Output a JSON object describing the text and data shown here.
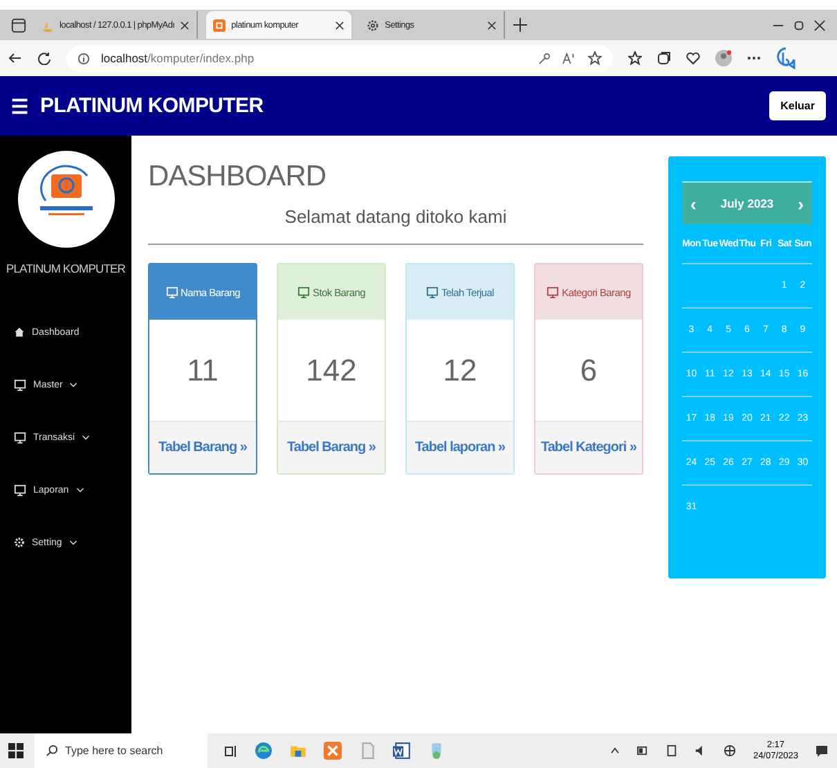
{
  "browser": {
    "tabs": [
      {
        "title": "localhost / 127.0.0.1 | phpMyAdı",
        "kind": "pma",
        "selected": false
      },
      {
        "title": "platinum komputer",
        "kind": "site",
        "selected": true
      },
      {
        "title": "Settings",
        "kind": "settings",
        "selected": false
      }
    ],
    "url_host": "localhost",
    "url_path": "/komputer/index.php"
  },
  "navbar": {
    "menu_glyph": "☰",
    "title": "PLATINUM KOMPUTER",
    "logout": "Keluar"
  },
  "sidebar": {
    "brand": "PLATINUM KOMPUTER",
    "items": [
      {
        "label": "Dashboard",
        "kind": "home",
        "submenu": false
      },
      {
        "label": "Master",
        "kind": "monitor",
        "submenu": true
      },
      {
        "label": "Transaksi",
        "kind": "monitor",
        "submenu": true
      },
      {
        "label": "Laporan",
        "kind": "monitor",
        "submenu": true
      },
      {
        "label": "Setting",
        "kind": "gear",
        "submenu": true
      }
    ]
  },
  "main": {
    "heading": "DASHBOARD",
    "welcome": "Selamat datang ditoko kami",
    "cards": [
      {
        "kind": "primary",
        "title": "Nama Barang",
        "value": "11",
        "link": "Tabel Barang",
        "arrow": "»"
      },
      {
        "kind": "success",
        "title": "Stok Barang",
        "value": "142",
        "link": "Tabel Barang",
        "arrow": "»"
      },
      {
        "kind": "info",
        "title": "Telah Terjual",
        "value": "12",
        "link": "Tabel laporan",
        "arrow": "»"
      },
      {
        "kind": "danger",
        "title": "Kategori Barang",
        "value": "6",
        "link": "Tabel Kategori",
        "arrow": "»"
      }
    ]
  },
  "calendar": {
    "prev": "‹",
    "month": "July 2023",
    "next": "›",
    "weekdays": [
      "Mon",
      "Tue",
      "Wed",
      "Thu",
      "Fri",
      "Sat",
      "Sun"
    ],
    "weeks": [
      [
        "1",
        "2"
      ],
      [
        "3",
        "4",
        "5",
        "6",
        "7",
        "8",
        "9"
      ],
      [
        "10",
        "11",
        "12",
        "13",
        "14",
        "15",
        "16"
      ],
      [
        "17",
        "18",
        "19",
        "20",
        "21",
        "22",
        "23"
      ],
      [
        "24",
        "25",
        "26",
        "27",
        "28",
        "29",
        "30"
      ],
      [
        "31"
      ]
    ]
  },
  "taskbar": {
    "search_placeholder": "Type here to search",
    "time": "2:17",
    "date": "24/07/2023"
  }
}
